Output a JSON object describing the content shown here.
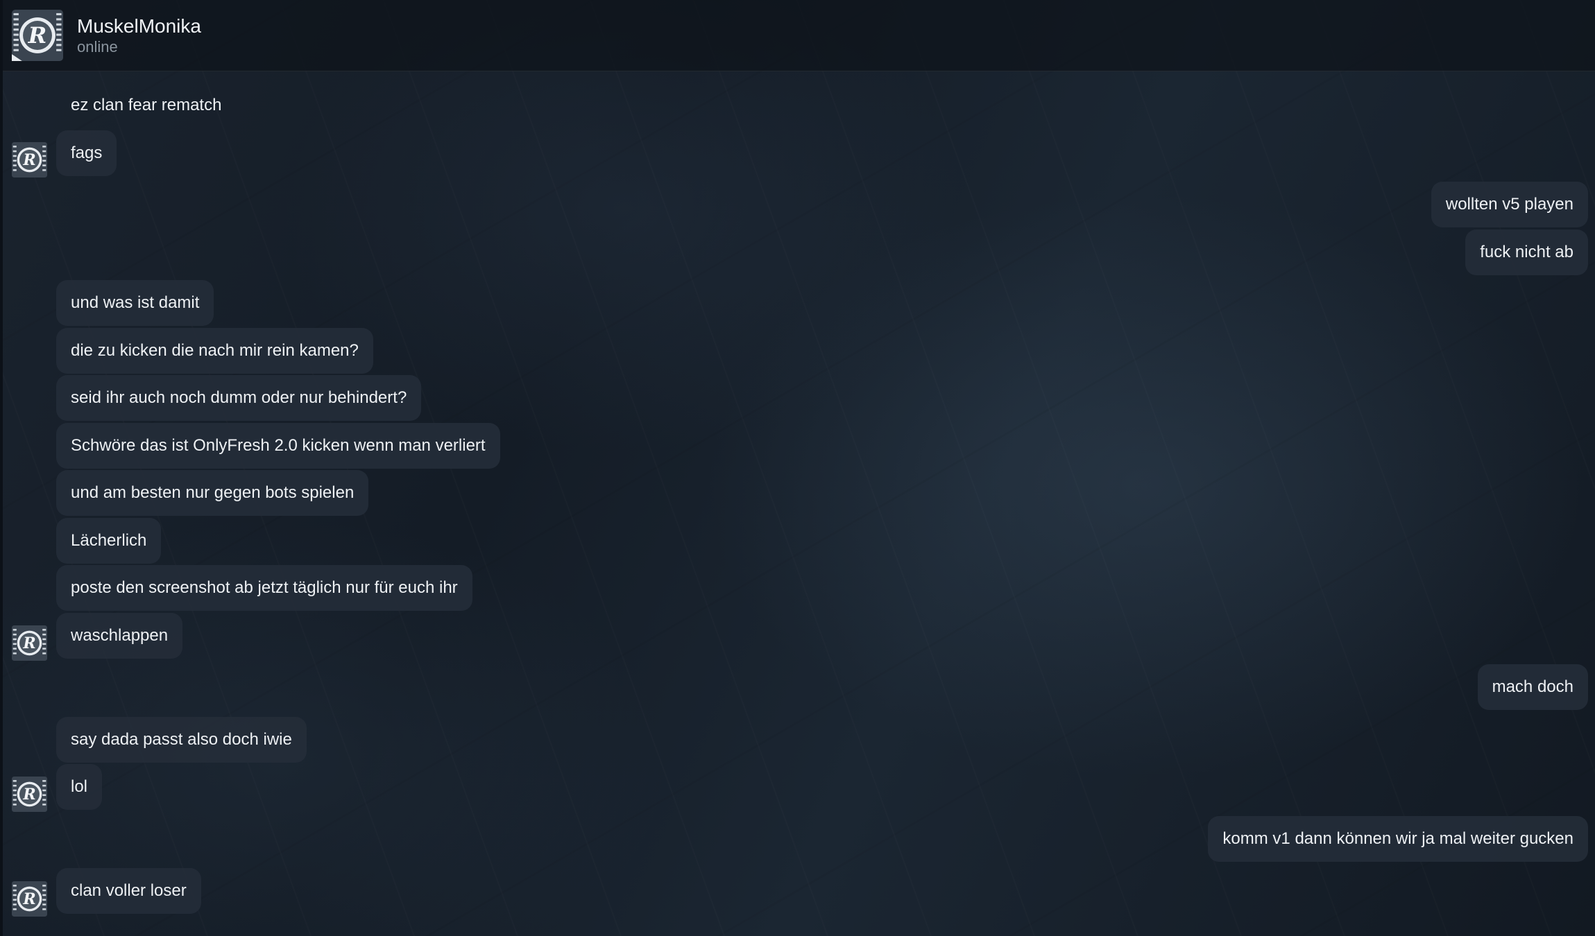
{
  "contact": {
    "name": "MuskelMonika",
    "status": "online"
  },
  "messages": [
    {
      "dir": "in",
      "text": "ez clan fear rematch"
    },
    {
      "dir": "in",
      "text": "fags"
    },
    {
      "dir": "out",
      "text": "wollten v5 playen"
    },
    {
      "dir": "out",
      "text": "fuck nicht ab"
    },
    {
      "dir": "in",
      "text": "und was ist damit"
    },
    {
      "dir": "in",
      "text": "die zu kicken die nach mir rein kamen?"
    },
    {
      "dir": "in",
      "text": "seid ihr auch noch dumm oder nur behindert?"
    },
    {
      "dir": "in",
      "text": "Schwöre das ist OnlyFresh 2.0 kicken wenn man verliert"
    },
    {
      "dir": "in",
      "text": "und am besten nur gegen bots spielen"
    },
    {
      "dir": "in",
      "text": "Lächerlich"
    },
    {
      "dir": "in",
      "text": "poste den screenshot ab jetzt täglich nur für euch ihr"
    },
    {
      "dir": "in",
      "text": "waschlappen"
    },
    {
      "dir": "out",
      "text": "mach doch"
    },
    {
      "dir": "in",
      "text": "say dada passt also doch iwie"
    },
    {
      "dir": "in",
      "text": "lol"
    },
    {
      "dir": "out",
      "text": "komm v1 dann können wir ja mal weiter gucken"
    },
    {
      "dir": "in",
      "text": "clan voller loser"
    }
  ],
  "icons": {
    "avatar": "rockstar-r-logo-icon"
  }
}
